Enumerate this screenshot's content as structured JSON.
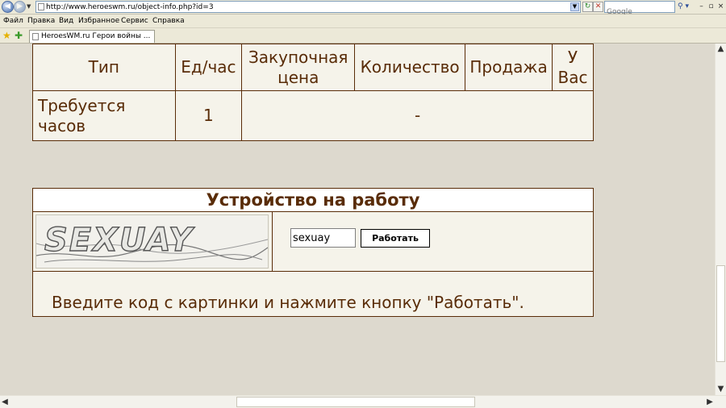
{
  "browser": {
    "url": "http://www.heroeswm.ru/object-info.php?id=3",
    "search_placeholder": "Google",
    "tab_title": "HeroesWM.ru Герои войны ...",
    "menu": [
      "Файл",
      "Правка",
      "Вид",
      "Избранное",
      "Сервис",
      "Справка"
    ]
  },
  "info_table": {
    "headers": [
      "Тип",
      "Ед/час",
      "Закупочная цена",
      "Количество",
      "Продажа",
      "У Вас"
    ],
    "row": {
      "type": "Требуется часов",
      "per_hour": "1",
      "rest": "-"
    }
  },
  "work": {
    "title": "Устройство на работу",
    "captcha_text": "SEXUAY",
    "code_value": "sexuay",
    "button_label": "Работать",
    "hint": "Введите код с картинки и нажмите кнопку \"Работать\"."
  },
  "colors": {
    "text_brown": "#592c08",
    "page_bg": "#ddd9ce",
    "cell_bg": "#f5f3ea"
  }
}
